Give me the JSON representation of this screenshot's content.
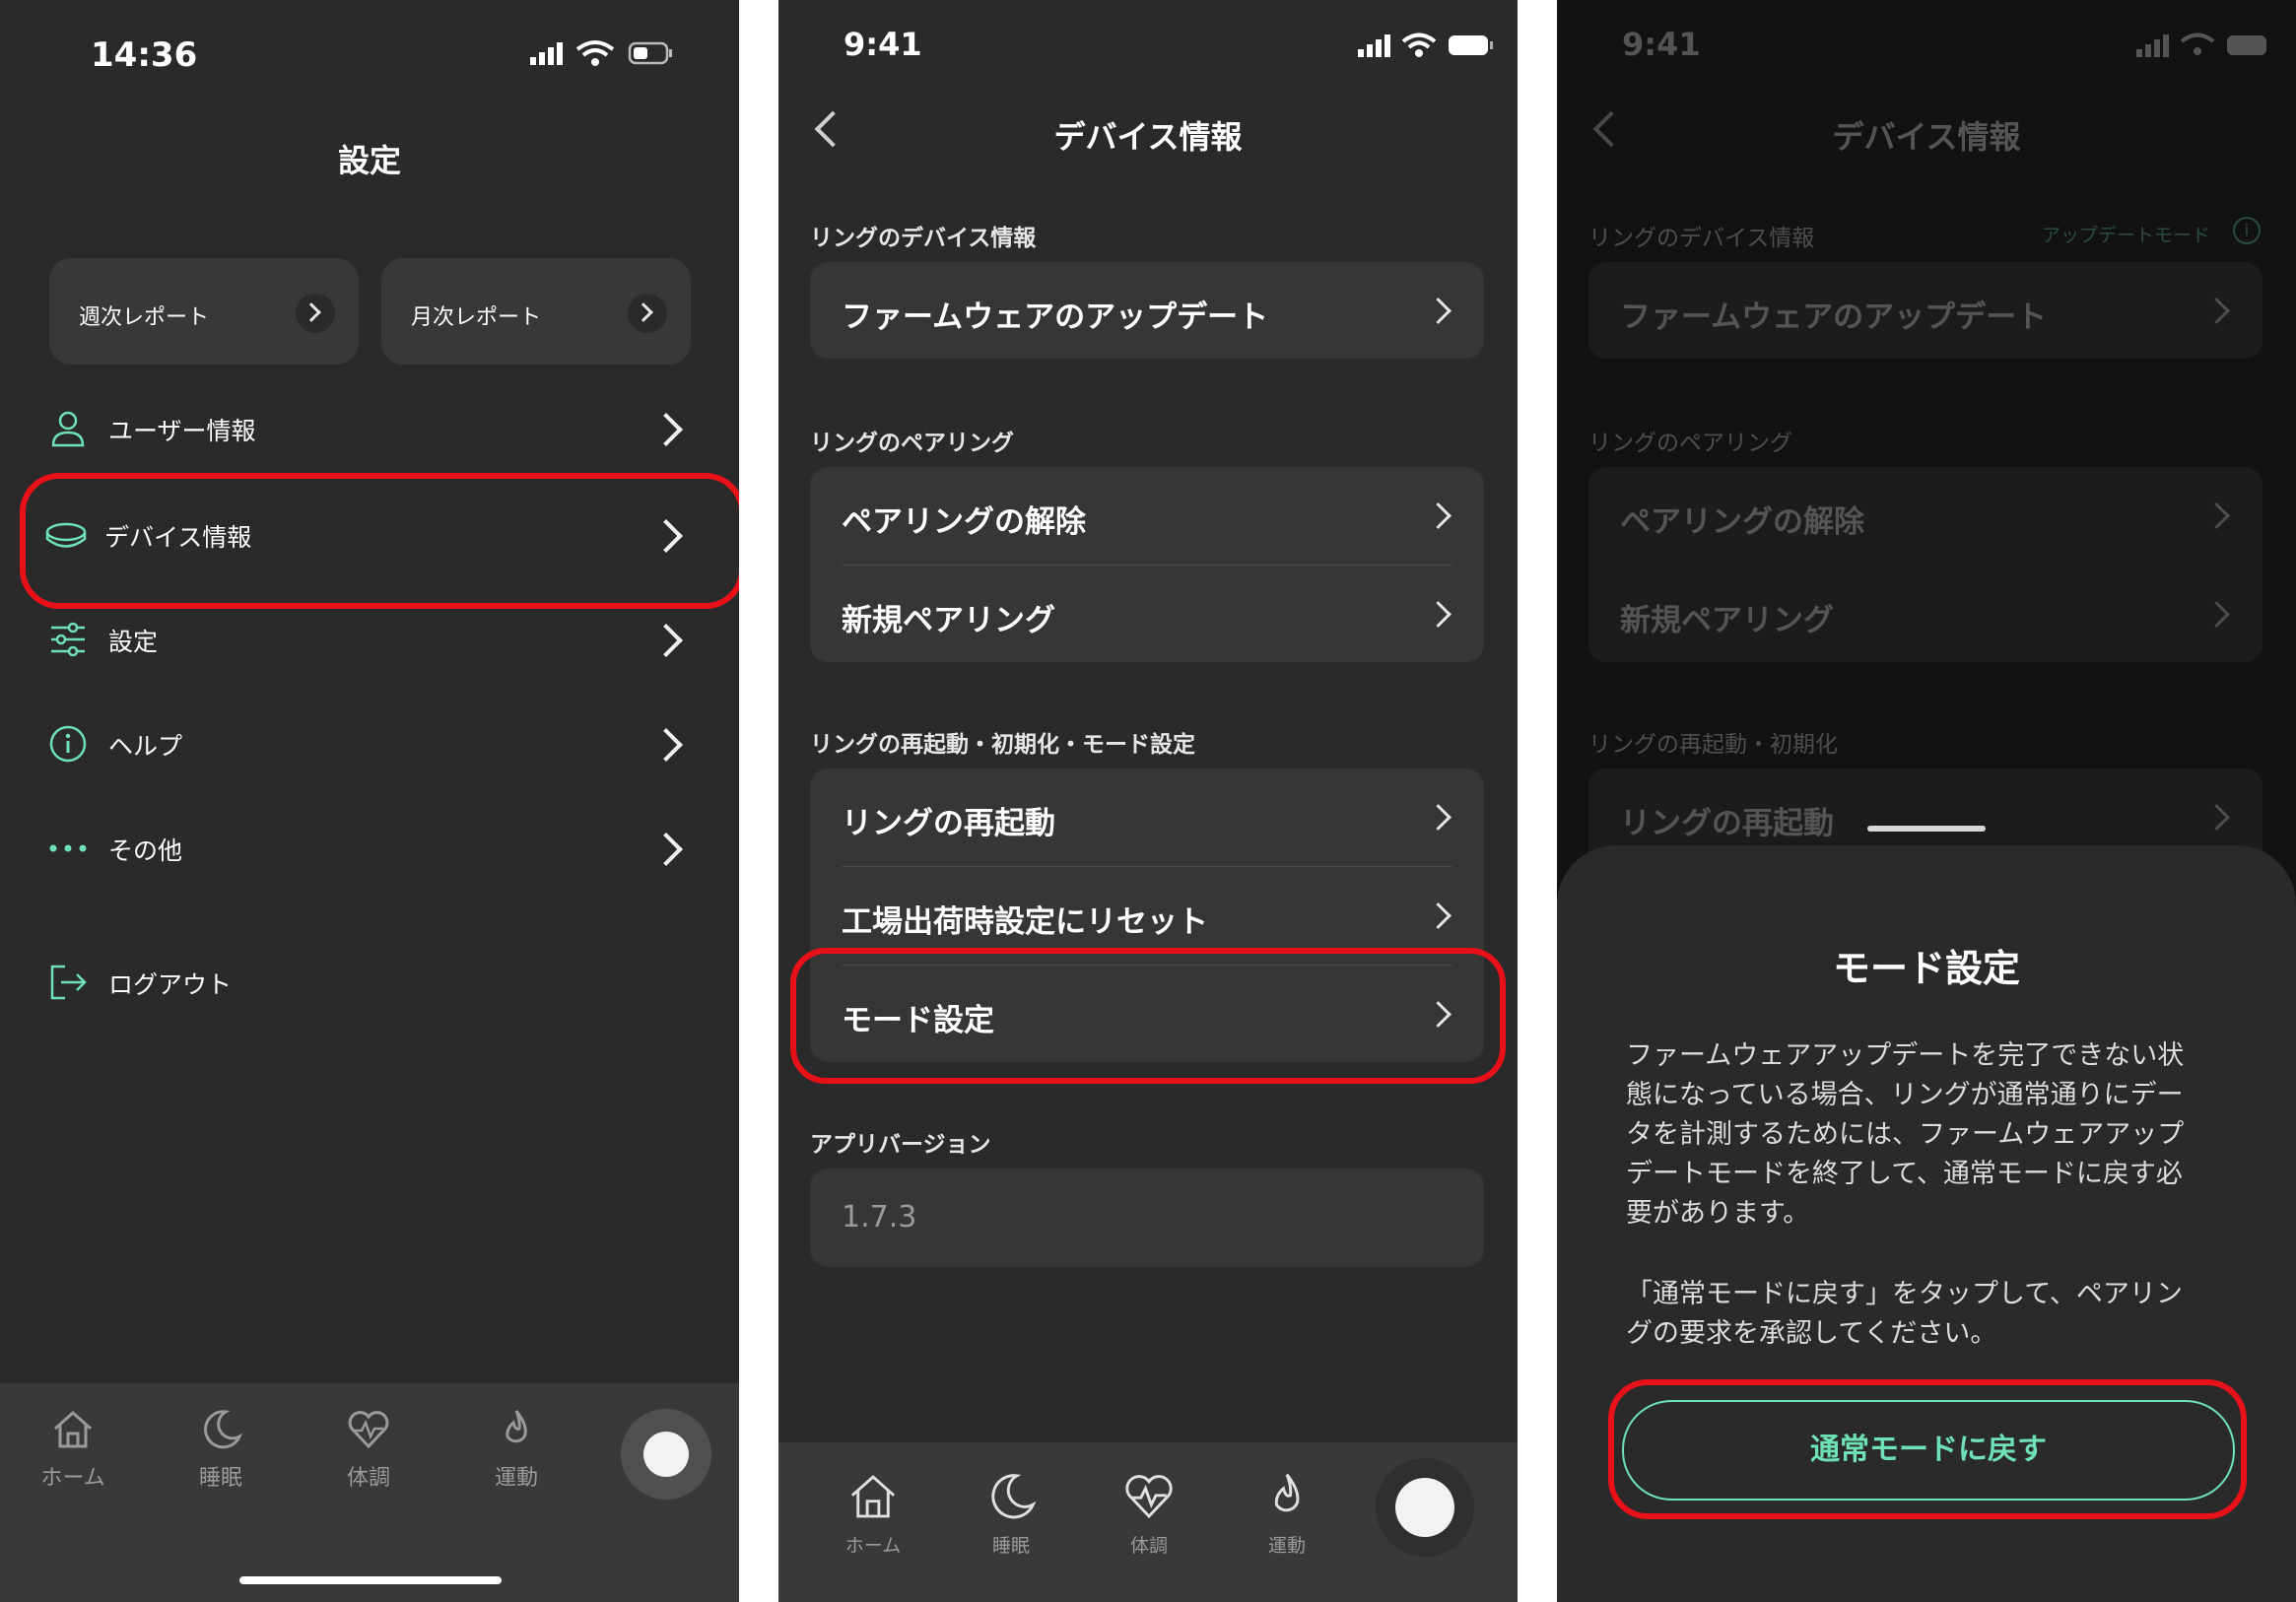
{
  "screen1": {
    "status_time": "14:36",
    "title": "設定",
    "reports": [
      {
        "label": "週次レポート"
      },
      {
        "label": "月次レポート"
      }
    ],
    "menu": [
      {
        "label": "ユーザー情報",
        "icon": "user-icon"
      },
      {
        "label": "デバイス情報",
        "icon": "ring-icon"
      },
      {
        "label": "設定",
        "icon": "sliders-icon"
      },
      {
        "label": "ヘルプ",
        "icon": "info-icon"
      },
      {
        "label": "その他",
        "icon": "more-icon"
      }
    ],
    "logout": "ログアウト",
    "tabs": [
      "ホーム",
      "睡眠",
      "体調",
      "運動"
    ]
  },
  "screen2": {
    "status_time": "9:41",
    "title": "デバイス情報",
    "sections": {
      "device_info": "リングのデバイス情報",
      "pairing": "リングのペアリング",
      "restart": "リングの再起動・初期化・モード設定",
      "app_version": "アプリバージョン"
    },
    "items": {
      "firmware": "ファームウェアのアップデート",
      "unpair": "ペアリングの解除",
      "new_pair": "新規ペアリング",
      "restart": "リングの再起動",
      "factory_reset": "工場出荷時設定にリセット",
      "mode": "モード設定"
    },
    "version": "1.7.3",
    "tabs": [
      "ホーム",
      "睡眠",
      "体調",
      "運動"
    ]
  },
  "screen3": {
    "status_time": "9:41",
    "title": "デバイス情報",
    "update_mode": "アップデートモード",
    "sections": {
      "device_info": "リングのデバイス情報",
      "pairing": "リングのペアリング",
      "restart": "リングの再起動・初期化"
    },
    "items": {
      "firmware": "ファームウェアのアップデート",
      "unpair": "ペアリングの解除",
      "new_pair": "新規ペアリング",
      "restart": "リングの再起動"
    },
    "sheet": {
      "title": "モード設定",
      "para1_lines": [
        "ファームウェアアップデートを完了できない状",
        "態になっている場合、リングが通常通りにデー",
        "タを計測するためには、ファームウェアアップ",
        "デートモードを終了して、通常モードに戻す必",
        "要があります。"
      ],
      "para2_lines": [
        "「通常モードに戻す」をタップして、ペアリン",
        "グの要求を承認してください。"
      ],
      "button": "通常モードに戻す"
    }
  },
  "colors": {
    "accent": "#6fe1b6",
    "highlight": "#e8111a",
    "background": "#2a2a2a"
  }
}
